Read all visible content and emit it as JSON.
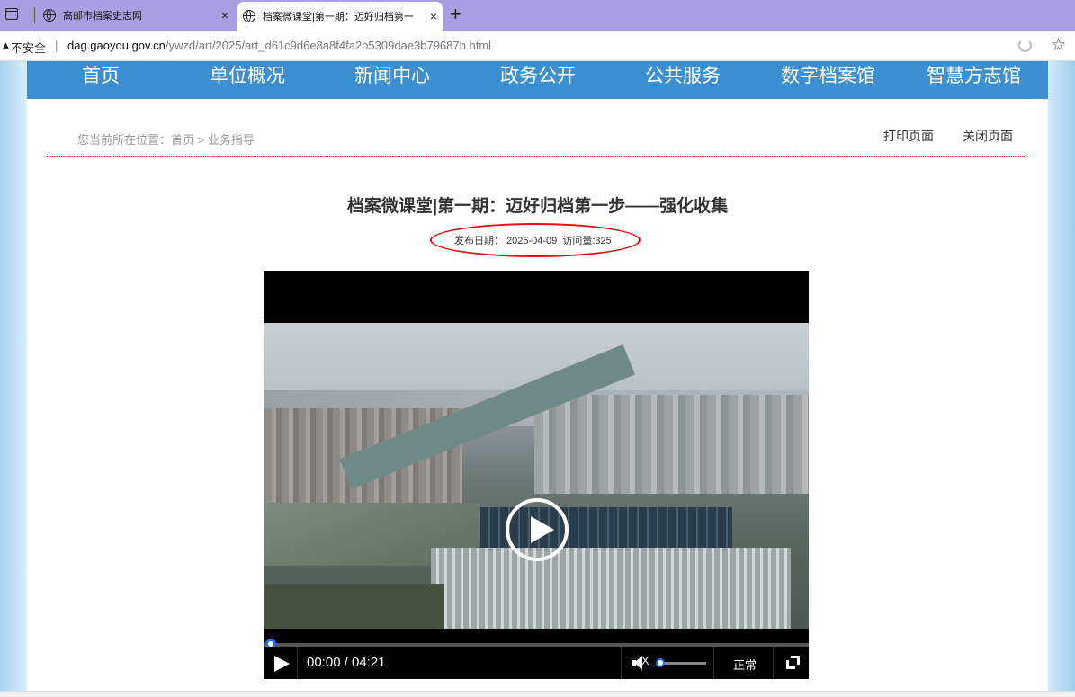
{
  "browser": {
    "tabs": [
      {
        "title": "高邮市档案史志网",
        "close": "×"
      },
      {
        "title": "档案微课堂|第一期：迈好归档第一",
        "close": "×"
      }
    ],
    "new_tab": "+",
    "security": "不安全",
    "separator": "|",
    "warn_glyph": "▲",
    "url_host": "dag.gaoyou.gov.cn",
    "url_path": "/ywzd/art/2025/art_d61c9d6e8a8f4fa2b5309dae3b79687b.html"
  },
  "nav": {
    "items": [
      "首页",
      "单位概况",
      "新闻中心",
      "政务公开",
      "公共服务",
      "数字档案馆",
      "智慧方志馆"
    ]
  },
  "breadcrumb": {
    "prefix": "您当前所在位置：",
    "home": "首页",
    "sep": " > ",
    "current": "业务指导"
  },
  "actions": {
    "print": "打印页面",
    "close": "关闭页面"
  },
  "article": {
    "title": "档案微课堂|第一期：迈好归档第一步——强化收集",
    "date_label": "发布日期：",
    "date": "2025-04-09",
    "views_label": "访问量:",
    "views": "325"
  },
  "video": {
    "time": "00:00 / 04:21",
    "rate": "正常",
    "mute_mark": "X",
    "progress": 0,
    "volume": 0
  }
}
